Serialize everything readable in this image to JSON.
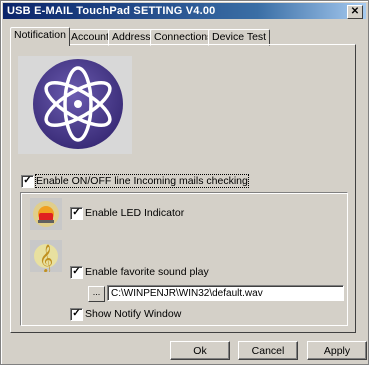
{
  "window": {
    "title": "USB E-MAIL TouchPad SETTING V4.00",
    "close_glyph": "✕"
  },
  "tabs": [
    {
      "label": "Notification",
      "active": true
    },
    {
      "label": "Accounts"
    },
    {
      "label": "Address"
    },
    {
      "label": "Connections"
    },
    {
      "label": "Device Test"
    }
  ],
  "notification": {
    "enable_checking": {
      "label": "Enable ON/OFF line Incoming mails checking",
      "checked": true
    },
    "led": {
      "label": "Enable LED Indicator",
      "checked": true,
      "icon": "led-indicator-icon"
    },
    "sound": {
      "label": "Enable favorite sound play",
      "checked": true,
      "icon": "music-note-icon",
      "browse_label": "...",
      "path": "C:\\WINPENJR\\WIN32\\default.wav"
    },
    "notify_window": {
      "label": "Show Notify Window",
      "checked": true
    }
  },
  "buttons": {
    "ok": "Ok",
    "cancel": "Cancel",
    "apply": "Apply"
  },
  "colors": {
    "titlebar": "#0a246a",
    "face": "#d4d0c8",
    "logo_bg": "#4b3c8c"
  }
}
